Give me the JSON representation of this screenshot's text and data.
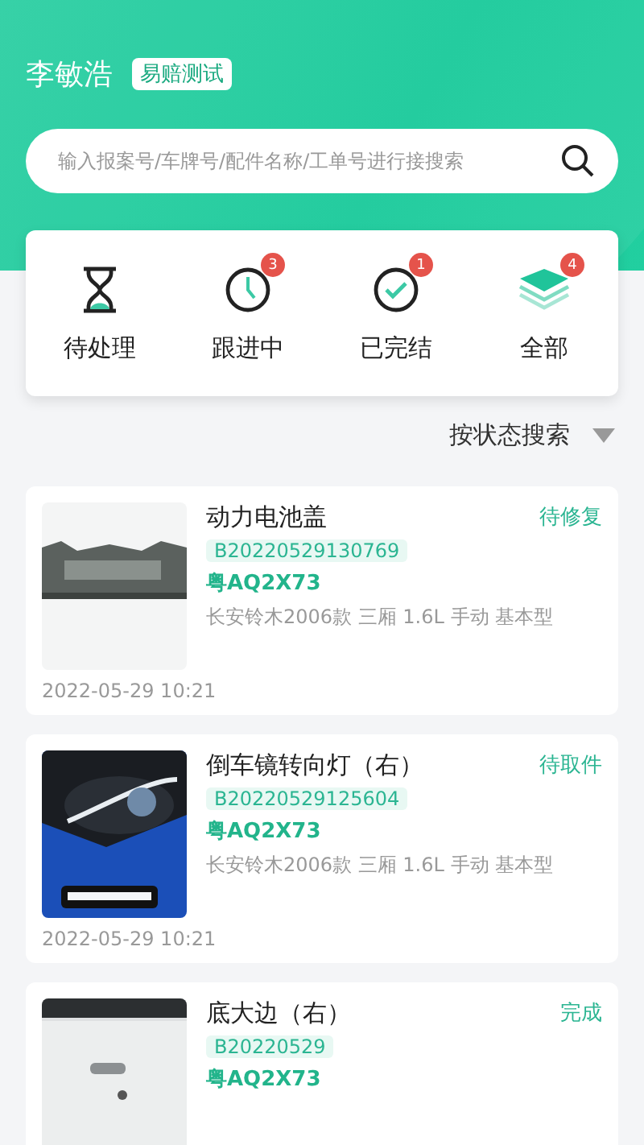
{
  "header": {
    "user_name": "李敏浩",
    "tag": "易赔测试"
  },
  "search": {
    "placeholder": "输入报案号/车牌号/配件名称/工单号进行接搜索"
  },
  "status_tabs": [
    {
      "label": "待处理"
    },
    {
      "label": "跟进中",
      "badge": "3"
    },
    {
      "label": "已完结",
      "badge": "1"
    },
    {
      "label": "全部",
      "badge": "4"
    }
  ],
  "filter": {
    "label": "按状态搜索"
  },
  "orders": [
    {
      "part": "动力电池盖",
      "status": "待修复",
      "order_no": "B20220529130769",
      "plate": "粤AQ2X73",
      "vehicle": "长安铃木2006款 三厢 1.6L 手动 基本型",
      "time": "2022-05-29 10:21"
    },
    {
      "part": "倒车镜转向灯（右）",
      "status": "待取件",
      "order_no": "B20220529125604",
      "plate": "粤AQ2X73",
      "vehicle": "长安铃木2006款 三厢 1.6L 手动 基本型",
      "time": "2022-05-29 10:21"
    },
    {
      "part": "底大边（右）",
      "status": "完成",
      "order_no": "B20220529",
      "plate": "粤AQ2X73"
    }
  ]
}
